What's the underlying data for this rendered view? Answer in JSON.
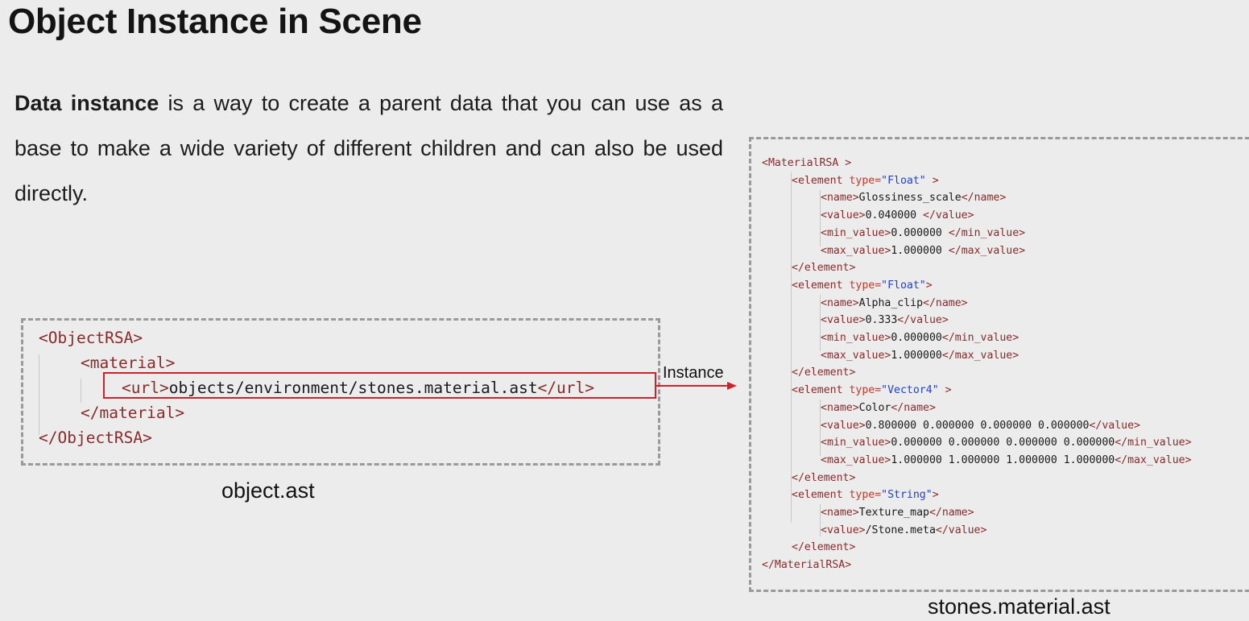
{
  "title": "Object Instance in Scene",
  "paragraph": {
    "bold": "Data instance",
    "rest": " is a way to create a parent data that you can use as a base to make a wide variety of different children and can also be used directly."
  },
  "object_ast": {
    "caption": "object.ast",
    "lines": [
      {
        "tag": "<ObjectRSA>",
        "indent": 0
      },
      {
        "tag": "<material>",
        "indent": 1
      },
      {
        "open": "<url>",
        "text": "objects/environment/stones.material.ast",
        "close": "</url>",
        "indent": 2
      },
      {
        "tag": "</material>",
        "indent": 1
      },
      {
        "tag": "</ObjectRSA>",
        "indent": 0
      }
    ]
  },
  "arrow_label": "Instance",
  "material_ast": {
    "caption": "stones.material.ast",
    "lines": [
      {
        "indent": 0,
        "parts": [
          {
            "c": "tag",
            "t": "<MaterialRSA >"
          }
        ]
      },
      {
        "indent": 1,
        "parts": [
          {
            "c": "tag",
            "t": "<element "
          },
          {
            "c": "attr",
            "t": "type="
          },
          {
            "c": "val",
            "t": "\"Float\""
          },
          {
            "c": "tag",
            "t": " >"
          }
        ]
      },
      {
        "indent": 2,
        "parts": [
          {
            "c": "tag",
            "t": "<name>"
          },
          {
            "c": "txt",
            "t": "Glossiness_scale"
          },
          {
            "c": "tag",
            "t": "</name>"
          }
        ]
      },
      {
        "indent": 2,
        "parts": [
          {
            "c": "tag",
            "t": "<value>"
          },
          {
            "c": "txt",
            "t": "0.040000 "
          },
          {
            "c": "tag",
            "t": "</value>"
          }
        ]
      },
      {
        "indent": 2,
        "parts": [
          {
            "c": "tag",
            "t": "<min_value>"
          },
          {
            "c": "txt",
            "t": "0.000000 "
          },
          {
            "c": "tag",
            "t": "</min_value>"
          }
        ]
      },
      {
        "indent": 2,
        "parts": [
          {
            "c": "tag",
            "t": "<max_value>"
          },
          {
            "c": "txt",
            "t": "1.000000 "
          },
          {
            "c": "tag",
            "t": "</max_value>"
          }
        ]
      },
      {
        "indent": 1,
        "parts": [
          {
            "c": "tag",
            "t": "</element>"
          }
        ]
      },
      {
        "indent": 1,
        "parts": [
          {
            "c": "tag",
            "t": "<element "
          },
          {
            "c": "attr",
            "t": "type="
          },
          {
            "c": "val",
            "t": "\"Float\""
          },
          {
            "c": "tag",
            "t": ">"
          }
        ]
      },
      {
        "indent": 2,
        "parts": [
          {
            "c": "tag",
            "t": "<name>"
          },
          {
            "c": "txt",
            "t": "Alpha_clip"
          },
          {
            "c": "tag",
            "t": "</name>"
          }
        ]
      },
      {
        "indent": 2,
        "parts": [
          {
            "c": "tag",
            "t": "<value>"
          },
          {
            "c": "txt",
            "t": "0.333"
          },
          {
            "c": "tag",
            "t": "</value>"
          }
        ]
      },
      {
        "indent": 2,
        "parts": [
          {
            "c": "tag",
            "t": "<min_value>"
          },
          {
            "c": "txt",
            "t": "0.000000"
          },
          {
            "c": "tag",
            "t": "</min_value>"
          }
        ]
      },
      {
        "indent": 2,
        "parts": [
          {
            "c": "tag",
            "t": "<max_value>"
          },
          {
            "c": "txt",
            "t": "1.000000"
          },
          {
            "c": "tag",
            "t": "</max_value>"
          }
        ]
      },
      {
        "indent": 1,
        "parts": [
          {
            "c": "tag",
            "t": "</element>"
          }
        ]
      },
      {
        "indent": 1,
        "parts": [
          {
            "c": "tag",
            "t": "<element "
          },
          {
            "c": "attr",
            "t": "type="
          },
          {
            "c": "val",
            "t": "\"Vector4\""
          },
          {
            "c": "tag",
            "t": " >"
          }
        ]
      },
      {
        "indent": 2,
        "parts": [
          {
            "c": "tag",
            "t": "<name>"
          },
          {
            "c": "txt",
            "t": "Color"
          },
          {
            "c": "tag",
            "t": "</name>"
          }
        ]
      },
      {
        "indent": 2,
        "parts": [
          {
            "c": "tag",
            "t": "<value>"
          },
          {
            "c": "txt",
            "t": "0.800000 0.000000 0.000000 0.000000"
          },
          {
            "c": "tag",
            "t": "</value>"
          }
        ]
      },
      {
        "indent": 2,
        "parts": [
          {
            "c": "tag",
            "t": "<min_value>"
          },
          {
            "c": "txt",
            "t": "0.000000 0.000000 0.000000 0.000000"
          },
          {
            "c": "tag",
            "t": "</min_value>"
          }
        ]
      },
      {
        "indent": 2,
        "parts": [
          {
            "c": "tag",
            "t": "<max_value>"
          },
          {
            "c": "txt",
            "t": "1.000000 1.000000 1.000000 1.000000"
          },
          {
            "c": "tag",
            "t": "</max_value>"
          }
        ]
      },
      {
        "indent": 1,
        "parts": [
          {
            "c": "tag",
            "t": "</element>"
          }
        ]
      },
      {
        "indent": 1,
        "parts": [
          {
            "c": "tag",
            "t": "<element "
          },
          {
            "c": "attr",
            "t": "type="
          },
          {
            "c": "val",
            "t": "\"String\""
          },
          {
            "c": "tag",
            "t": ">"
          }
        ]
      },
      {
        "indent": 2,
        "parts": [
          {
            "c": "tag",
            "t": "<name>"
          },
          {
            "c": "txt",
            "t": "Texture_map"
          },
          {
            "c": "tag",
            "t": "</name>"
          }
        ]
      },
      {
        "indent": 2,
        "parts": [
          {
            "c": "tag",
            "t": "<value>"
          },
          {
            "c": "txt",
            "t": "/Stone.meta"
          },
          {
            "c": "tag",
            "t": "</value>"
          }
        ]
      },
      {
        "indent": 1,
        "parts": [
          {
            "c": "tag",
            "t": "</element>"
          }
        ]
      },
      {
        "indent": 0,
        "parts": [
          {
            "c": "tag",
            "t": "</MaterialRSA>"
          }
        ]
      }
    ]
  },
  "colors": {
    "tag": "#8b2a2a",
    "attr": "#c0392b",
    "value": "#1f3fd8",
    "highlight": "#d0202a"
  }
}
